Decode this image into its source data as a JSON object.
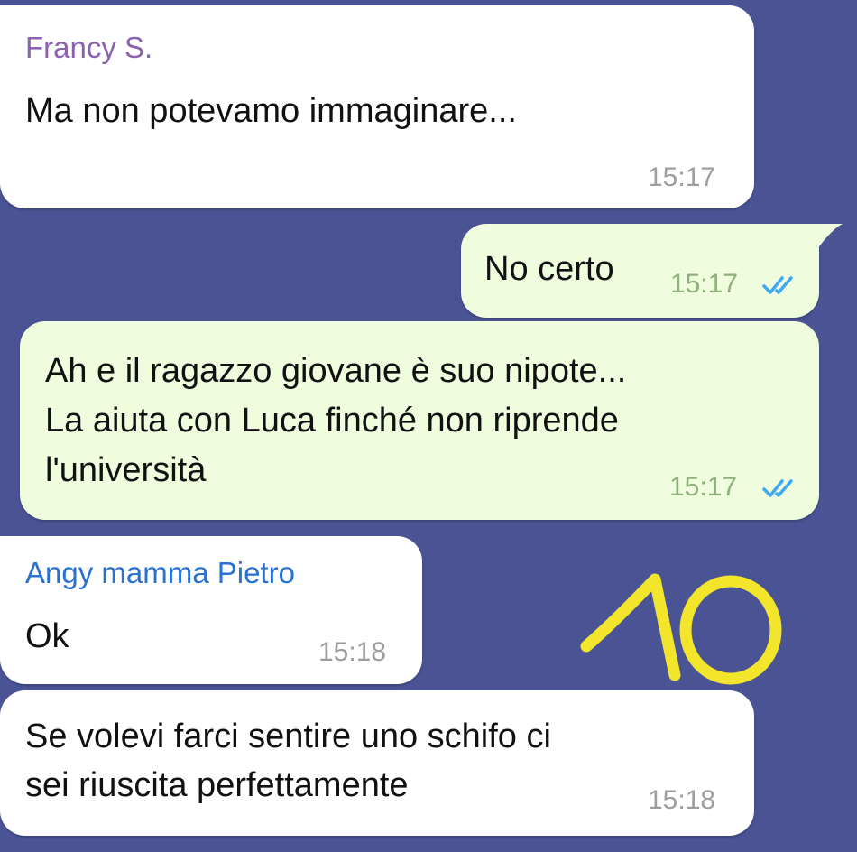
{
  "messages": [
    {
      "sender": "Francy S.",
      "text": "Ma non potevamo immaginare...",
      "time": "15:17"
    },
    {
      "text": "No certo",
      "time": "15:17"
    },
    {
      "lines": [
        "Ah e il ragazzo giovane è suo nipote...",
        "La aiuta con Luca finché non riprende",
        "l'università"
      ],
      "time": "15:17"
    },
    {
      "sender": "Angy mamma Pietro",
      "text": "Ok",
      "time": "15:18"
    },
    {
      "lines": [
        "Se volevi farci sentire uno schifo ci",
        "sei riuscita perfettamente"
      ],
      "time": "15:18"
    }
  ],
  "annotation": {
    "text": "10",
    "color": "#f2e52b"
  },
  "colors": {
    "background": "#4a5394",
    "incoming": "#ffffff",
    "outgoing": "#effdde",
    "sender_francy": "#8b62b0",
    "sender_angy": "#2a72d2",
    "read_check": "#3fa9f5"
  },
  "icons": {
    "read_receipt": "double-check-icon"
  }
}
